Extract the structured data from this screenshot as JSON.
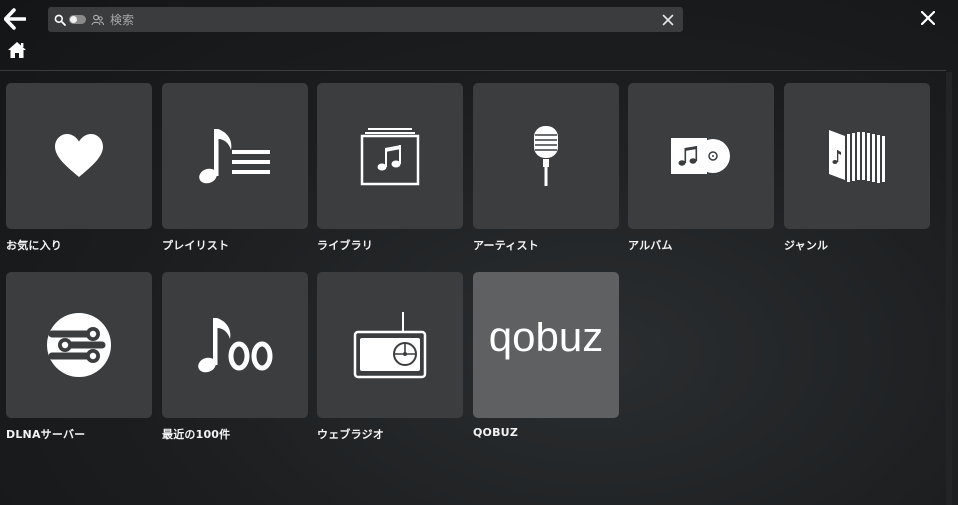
{
  "search": {
    "placeholder": "検索",
    "value": ""
  },
  "header": {
    "back_icon": "arrow-left-icon",
    "home_icon": "home-icon",
    "close_icon": "close-icon",
    "clear_icon": "clear-search-icon"
  },
  "tiles": [
    {
      "label": "お気に入り",
      "icon": "heart-icon"
    },
    {
      "label": "プレイリスト",
      "icon": "playlist-icon"
    },
    {
      "label": "ライブラリ",
      "icon": "library-icon"
    },
    {
      "label": "アーティスト",
      "icon": "microphone-icon"
    },
    {
      "label": "アルバム",
      "icon": "album-icon"
    },
    {
      "label": "ジャンル",
      "icon": "genre-icon"
    },
    {
      "label": "DLNAサーバー",
      "icon": "dlna-icon"
    },
    {
      "label": "最近の100件",
      "icon": "recent-100-icon"
    },
    {
      "label": "ウェブラジオ",
      "icon": "radio-icon"
    },
    {
      "label": "QOBUZ",
      "icon": "qobuz-logo",
      "logo_text": "qobuz"
    }
  ]
}
